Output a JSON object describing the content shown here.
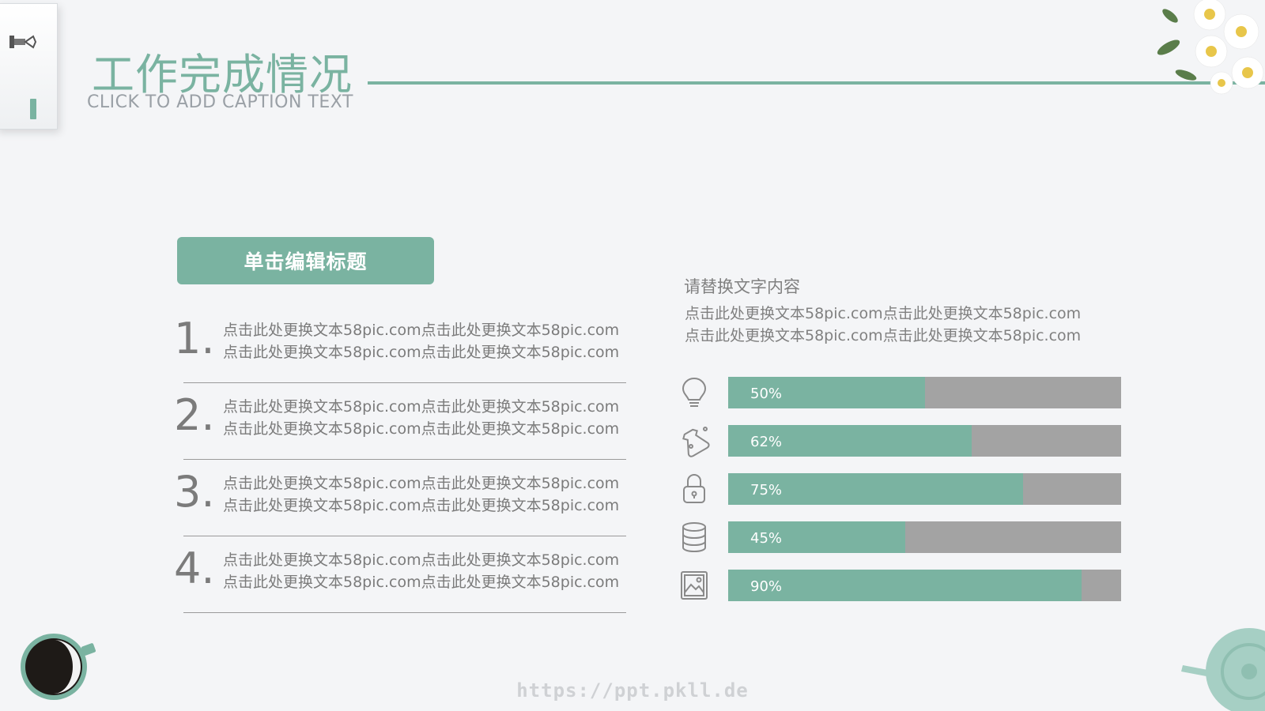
{
  "header": {
    "title": "工作完成情况",
    "subtitle": "CLICK TO ADD CAPTION TEXT"
  },
  "left": {
    "heading": "单击编辑标题",
    "items": [
      {
        "num": "1.",
        "line1": "点击此处更换文本58pic.com点击此处更换文本58pic.com",
        "line2": "点击此处更换文本58pic.com点击此处更换文本58pic.com"
      },
      {
        "num": "2.",
        "line1": "点击此处更换文本58pic.com点击此处更换文本58pic.com",
        "line2": "点击此处更换文本58pic.com点击此处更换文本58pic.com"
      },
      {
        "num": "3.",
        "line1": "点击此处更换文本58pic.com点击此处更换文本58pic.com",
        "line2": "点击此处更换文本58pic.com点击此处更换文本58pic.com"
      },
      {
        "num": "4.",
        "line1": "点击此处更换文本58pic.com点击此处更换文本58pic.com",
        "line2": "点击此处更换文本58pic.com点击此处更换文本58pic.com"
      }
    ]
  },
  "right": {
    "title": "请替换文字内容",
    "body_line1": "点击此处更换文本58pic.com点击此处更换文本58pic.com",
    "body_line2": "点击此处更换文本58pic.com点击此处更换文本58pic.com",
    "bars": [
      {
        "label": "50%",
        "value": 0.5,
        "icon": "lightbulb-icon"
      },
      {
        "label": "62%",
        "value": 0.62,
        "icon": "flask-icon"
      },
      {
        "label": "75%",
        "value": 0.75,
        "icon": "lock-icon"
      },
      {
        "label": "45%",
        "value": 0.45,
        "icon": "database-icon"
      },
      {
        "label": "90%",
        "value": 0.9,
        "icon": "image-icon"
      }
    ]
  },
  "watermark": "https://ppt.pkll.de",
  "colors": {
    "accent": "#7ab3a1",
    "track": "#a3a3a3",
    "background": "#f4f5f7",
    "text": "#7b7b7b"
  }
}
